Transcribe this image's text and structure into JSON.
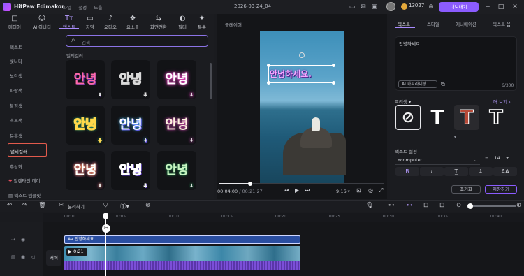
{
  "app": {
    "name": "HitPaw Edimakor",
    "menu": [
      "파일",
      "설정",
      "도움"
    ],
    "doc_title": "2026-03-24_04",
    "coins": "13027",
    "export_label": "내보내기"
  },
  "media_tabs": [
    {
      "label": "미디어",
      "icon": "□"
    },
    {
      "label": "AI 아바타",
      "icon": "☺"
    },
    {
      "label": "텍스트",
      "icon": "Tт"
    },
    {
      "label": "자막",
      "icon": "▭"
    },
    {
      "label": "오디오",
      "icon": "♪"
    },
    {
      "label": "요소들",
      "icon": "❖"
    },
    {
      "label": "화면전환",
      "icon": "⇆"
    },
    {
      "label": "필터",
      "icon": "◐"
    },
    {
      "label": "특수",
      "icon": "✦"
    }
  ],
  "categories": [
    "텍스트",
    "빛나다",
    "노란색",
    "파랑색",
    "불평색",
    "초록색",
    "분홍색",
    "멀티컬러",
    "추상화",
    "발렌타인 데이",
    "텍스트 템플릿"
  ],
  "selected_category": "멀티컬러",
  "search": {
    "placeholder": "검색"
  },
  "section_title": "멀티컬러",
  "cards": [
    "안녕",
    "안녕",
    "안녕",
    "안녕",
    "안녕",
    "안녕",
    "안녕",
    "안녕",
    "안녕"
  ],
  "preview": {
    "label": "플레이어",
    "caption": "안녕하세요.",
    "current_time": "00:04:00",
    "total_time": "00:21:27",
    "ratio": "9:16"
  },
  "right_tabs": [
    "텍스트",
    "스타일",
    "애니메이션",
    "텍스트 음"
  ],
  "text_editor": {
    "value": "안녕하세요.",
    "ai_button": "AI 카피라이팅",
    "count": "6/300"
  },
  "presets": {
    "label": "프리셋",
    "more": "더 보기",
    "items": [
      "⊘",
      "T",
      "T",
      "T"
    ]
  },
  "text_settings": {
    "label": "텍스트 설정",
    "font": "Ycomputer",
    "size": "14",
    "format": [
      "B",
      "I",
      "T̲",
      "↕",
      "AA"
    ]
  },
  "actions": {
    "reset": "초기화",
    "save": "저장하기"
  },
  "timeline": {
    "split_label": "분리하기",
    "ruler": [
      "00:00",
      "00:05",
      "00:10",
      "00:15",
      "00:20",
      "00:25",
      "00:30",
      "00:35",
      "00:40"
    ],
    "caption_clip": "Aa 안녕하세요.",
    "video_clip_time": "0:21",
    "cover_label": "커버"
  }
}
